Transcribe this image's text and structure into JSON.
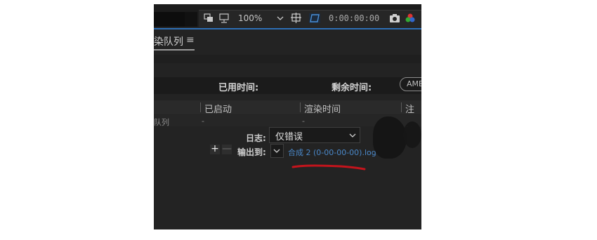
{
  "toolbar": {
    "zoom": "100%",
    "timecode": "0:00:00:00"
  },
  "panel": {
    "tab_label": "染队列",
    "tab_menu_icon": "≡"
  },
  "status": {
    "elapsed_label": "已用时间:",
    "remaining_label": "剩余时间:",
    "ame_button": "AME"
  },
  "columns": [
    {
      "label": "已启动"
    },
    {
      "label": "渲染时间"
    },
    {
      "label": "注释"
    }
  ],
  "queue_row": {
    "name": "队列",
    "started": "-",
    "render_time": "-"
  },
  "log": {
    "label": "日志:",
    "value": "仅错误"
  },
  "output": {
    "label": "输出到:",
    "path": "合成 2 (0-00-00-00).log",
    "add_label": "+",
    "remove_label": "—"
  },
  "colors": {
    "panel_bg": "#232323",
    "accent_blue": "#2d6fb5",
    "link_blue": "#4a88c9",
    "annotation_red": "#c4141c"
  },
  "icons": [
    "monitor-icon",
    "display-icon",
    "chevron-down-icon",
    "grid-icon",
    "roi-icon",
    "camera-icon",
    "color-channels-icon",
    "hamburger-menu-icon"
  ]
}
